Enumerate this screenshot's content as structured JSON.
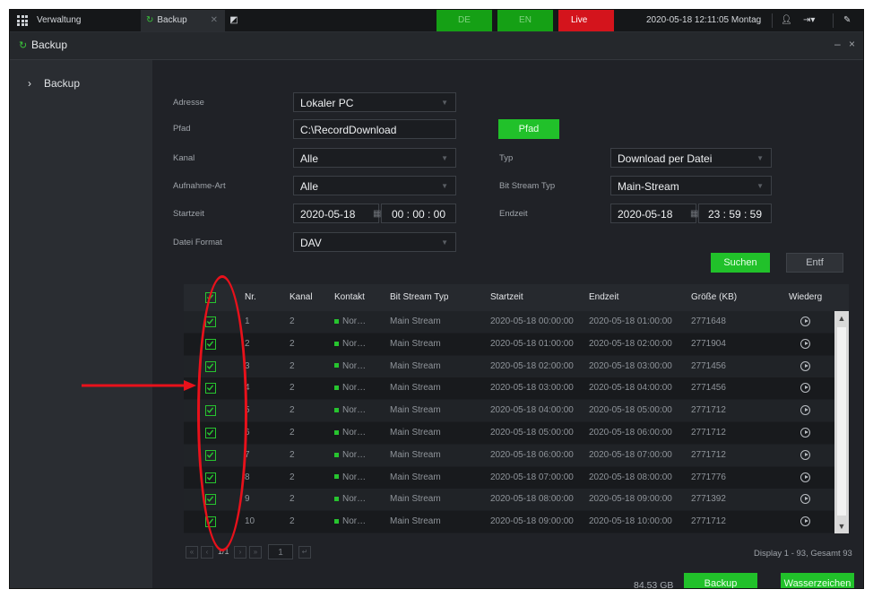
{
  "topbar": {
    "manage_tab": "Verwaltung",
    "backup_tab": "Backup",
    "lang_de": "DE",
    "lang_en": "EN",
    "live": "Live",
    "datetime": "2020-05-18 12:11:05 Montag"
  },
  "window": {
    "title": "Backup",
    "controls": "– ×"
  },
  "sidebar": {
    "items": [
      {
        "label": "Backup"
      }
    ]
  },
  "form": {
    "address_label": "Adresse",
    "address_value": "Lokaler PC",
    "path_label": "Pfad",
    "path_value": "C:\\RecordDownload",
    "path_button": "Pfad",
    "channel_label": "Kanal",
    "channel_value": "Alle",
    "type_label": "Typ",
    "type_value": "Download per Datei",
    "rectype_label": "Aufnahme-Art",
    "rectype_value": "Alle",
    "bitstream_label": "Bit Stream Typ",
    "bitstream_value": "Main-Stream",
    "start_label": "Startzeit",
    "start_date": "2020-05-18",
    "start_time": "00 : 00 : 00",
    "end_label": "Endzeit",
    "end_date": "2020-05-18",
    "end_time": "23 : 59 : 59",
    "format_label": "Datei Format",
    "format_value": "DAV",
    "search_button": "Suchen",
    "clear_button": "Entf"
  },
  "table": {
    "columns": [
      "Nr.",
      "Kanal",
      "Kontakt",
      "Bit Stream Typ",
      "Startzeit",
      "Endzeit",
      "Größe (KB)",
      "Wiederg"
    ],
    "rows": [
      {
        "nr": "1",
        "kanal": "2",
        "kontakt": "Nor…",
        "stream": "Main Stream",
        "start": "2020-05-18 00:00:00",
        "end": "2020-05-18 01:00:00",
        "size": "2771648"
      },
      {
        "nr": "2",
        "kanal": "2",
        "kontakt": "Nor…",
        "stream": "Main Stream",
        "start": "2020-05-18 01:00:00",
        "end": "2020-05-18 02:00:00",
        "size": "2771904"
      },
      {
        "nr": "3",
        "kanal": "2",
        "kontakt": "Nor…",
        "stream": "Main Stream",
        "start": "2020-05-18 02:00:00",
        "end": "2020-05-18 03:00:00",
        "size": "2771456"
      },
      {
        "nr": "4",
        "kanal": "2",
        "kontakt": "Nor…",
        "stream": "Main Stream",
        "start": "2020-05-18 03:00:00",
        "end": "2020-05-18 04:00:00",
        "size": "2771456"
      },
      {
        "nr": "5",
        "kanal": "2",
        "kontakt": "Nor…",
        "stream": "Main Stream",
        "start": "2020-05-18 04:00:00",
        "end": "2020-05-18 05:00:00",
        "size": "2771712"
      },
      {
        "nr": "6",
        "kanal": "2",
        "kontakt": "Nor…",
        "stream": "Main Stream",
        "start": "2020-05-18 05:00:00",
        "end": "2020-05-18 06:00:00",
        "size": "2771712"
      },
      {
        "nr": "7",
        "kanal": "2",
        "kontakt": "Nor…",
        "stream": "Main Stream",
        "start": "2020-05-18 06:00:00",
        "end": "2020-05-18 07:00:00",
        "size": "2771712"
      },
      {
        "nr": "8",
        "kanal": "2",
        "kontakt": "Nor…",
        "stream": "Main Stream",
        "start": "2020-05-18 07:00:00",
        "end": "2020-05-18 08:00:00",
        "size": "2771776"
      },
      {
        "nr": "9",
        "kanal": "2",
        "kontakt": "Nor…",
        "stream": "Main Stream",
        "start": "2020-05-18 08:00:00",
        "end": "2020-05-18 09:00:00",
        "size": "2771392"
      },
      {
        "nr": "10",
        "kanal": "2",
        "kontakt": "Nor…",
        "stream": "Main Stream",
        "start": "2020-05-18 09:00:00",
        "end": "2020-05-18 10:00:00",
        "size": "2771712"
      }
    ]
  },
  "pager": {
    "page_info": "1/1",
    "page_input": "1",
    "display_info": "Display 1 - 93, Gesamt 93"
  },
  "footer": {
    "size_total": "84.53 GB",
    "backup_button": "Backup",
    "watermark_button": "Wasserzeichen"
  },
  "colors": {
    "accent_green": "#21c12a",
    "live_red": "#d4141c",
    "annotation_red": "#e8111b"
  }
}
